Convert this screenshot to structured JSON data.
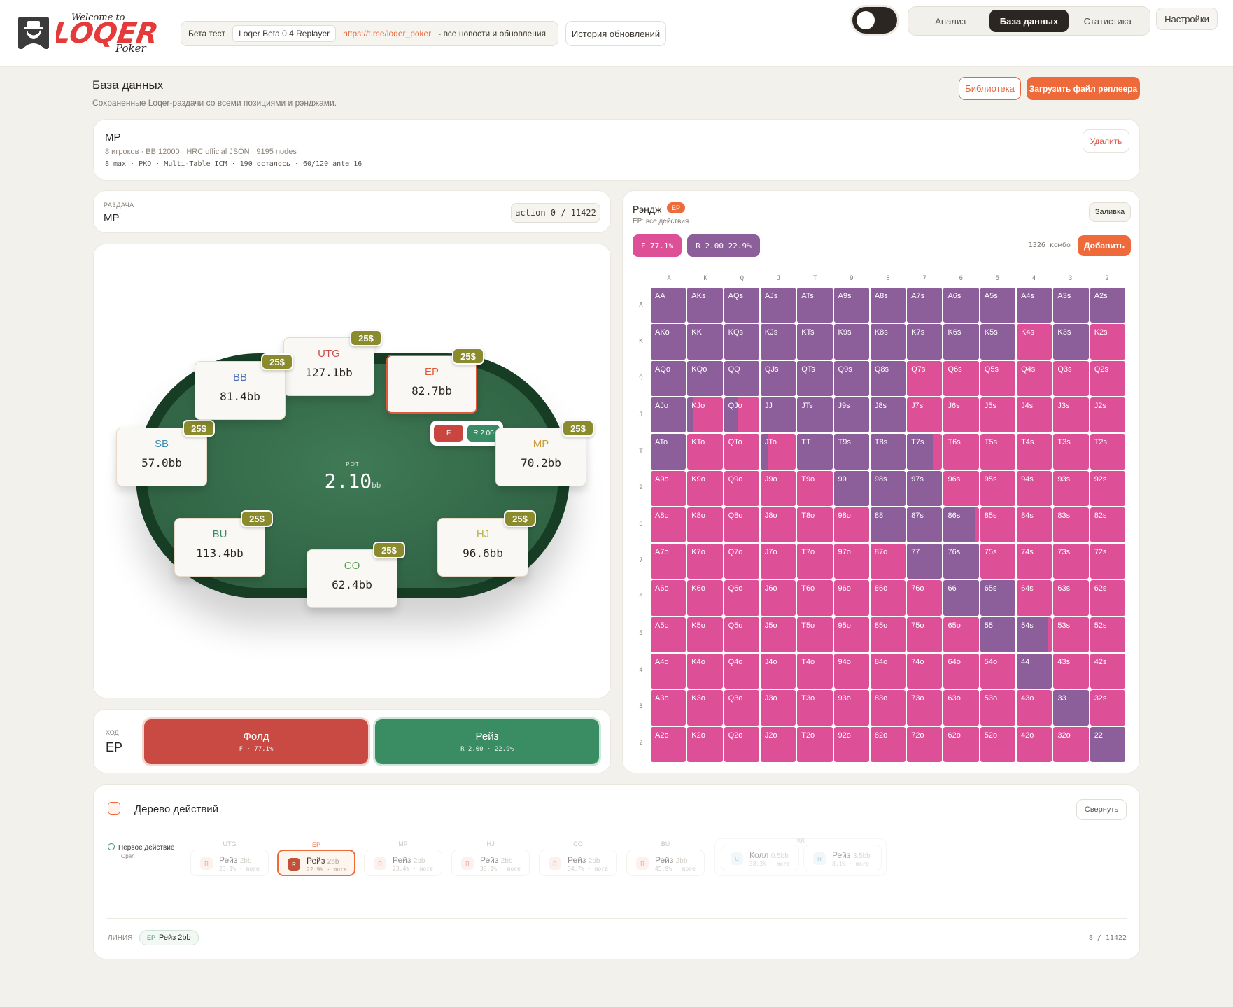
{
  "header": {
    "logo_alt": "Welcome to LOQER Poker",
    "beta_label": "Бета тест",
    "version_tag": "Loqer Beta 0.4 Replayer",
    "link": "https://t.me/loqer_poker",
    "link_suffix": "- все новости и обновления",
    "history_button": "История обновлений",
    "tabs": [
      "Анализ",
      "База данных",
      "Статистика"
    ],
    "active_tab": "База данных",
    "settings_button": "Настройки"
  },
  "page": {
    "title": "База данных",
    "subtitle": "Сохраненные Loqer-раздачи со всеми позициями и рэнджами.",
    "library_button": "Библиотека",
    "upload_button": "Загрузить файл реплеера"
  },
  "hand": {
    "name": "MP",
    "meta": "8 игроков · BB 12000 · HRC official JSON · 9195 nodes",
    "meta2": "8 max · PKO · Multi-Table ICM · 190 осталось · 60/120 ante 16",
    "delete_button": "Удалить"
  },
  "deal": {
    "label": "РАЗДАЧА",
    "name": "MP",
    "action_counter": "action 0 / 11422"
  },
  "table": {
    "pot_label": "POT",
    "pot_value": "2.10",
    "pot_unit": "bb",
    "seats": [
      {
        "pos": "UTG",
        "stack": "127.1bb",
        "chip": "25$",
        "color": "#c8504e"
      },
      {
        "pos": "EP",
        "stack": "82.7bb",
        "chip": "25$",
        "color": "#e2583a"
      },
      {
        "pos": "MP",
        "stack": "70.2bb",
        "chip": "25$",
        "color": "#c89a3c"
      },
      {
        "pos": "HJ",
        "stack": "96.6bb",
        "chip": "25$",
        "color": "#b9b34a"
      },
      {
        "pos": "CO",
        "stack": "62.4bb",
        "chip": "25$",
        "color": "#5a9e55"
      },
      {
        "pos": "BU",
        "stack": "113.4bb",
        "chip": "25$",
        "color": "#3a8d63"
      },
      {
        "pos": "SB",
        "stack": "57.0bb",
        "chip": "25$",
        "color": "#3a8fb5"
      },
      {
        "pos": "BB",
        "stack": "81.4bb",
        "chip": "25$",
        "color": "#4a6fb5"
      }
    ],
    "active_actions": {
      "fold": "F",
      "raise": "R 2.00"
    }
  },
  "move": {
    "label": "ХОД",
    "position": "EP",
    "fold_title": "Фолд",
    "fold_sub": "F · 77.1%",
    "raise_title": "Рейз",
    "raise_sub": "R 2.00 · 22.9%"
  },
  "range": {
    "title": "Рэндж",
    "badge": "EP",
    "subtitle": "EP: все действия",
    "fill_button": "Заливка",
    "fold_pill": "F 77.1%",
    "raise_pill": "R 2.00 22.9%",
    "combo_count": "1326 комбо",
    "add_button": "Добавить",
    "ranks": [
      "A",
      "K",
      "Q",
      "J",
      "T",
      "9",
      "8",
      "7",
      "6",
      "5",
      "4",
      "3",
      "2"
    ],
    "colors": {
      "fold": "#dd4f96",
      "raise": "#8c5e9a"
    },
    "raise_freq": [
      [
        1,
        1,
        1,
        1,
        1,
        1,
        1,
        1,
        1,
        1,
        1,
        1,
        1
      ],
      [
        1,
        1,
        1,
        1,
        1,
        1,
        1,
        1,
        1,
        1,
        0,
        1,
        0
      ],
      [
        1,
        1,
        1,
        1,
        1,
        1,
        1,
        0,
        0,
        0,
        0,
        0,
        0
      ],
      [
        1,
        0.15,
        0.4,
        1,
        1,
        1,
        1,
        0,
        0,
        0,
        0,
        0,
        0
      ],
      [
        1,
        0,
        0,
        0.2,
        1,
        1,
        1,
        0.75,
        0,
        0,
        0,
        0,
        0
      ],
      [
        0,
        0,
        0,
        0,
        0,
        1,
        1,
        1,
        0,
        0,
        0,
        0,
        0
      ],
      [
        0,
        0,
        0,
        0,
        0,
        0,
        1,
        1,
        0.9,
        0,
        0,
        0,
        0
      ],
      [
        0,
        0,
        0,
        0,
        0,
        0,
        0,
        1,
        1,
        0,
        0,
        0,
        0
      ],
      [
        0,
        0,
        0,
        0,
        0,
        0,
        0,
        0,
        1,
        1,
        0,
        0,
        0
      ],
      [
        0,
        0,
        0,
        0,
        0,
        0,
        0,
        0,
        0,
        1,
        0.9,
        0,
        0
      ],
      [
        0,
        0,
        0,
        0,
        0,
        0,
        0,
        0,
        0,
        0,
        1,
        0,
        0
      ],
      [
        0,
        0,
        0,
        0,
        0,
        0,
        0,
        0,
        0,
        0,
        0,
        1,
        0
      ],
      [
        0,
        0,
        0,
        0,
        0,
        0,
        0,
        0,
        0,
        0,
        0,
        0,
        1
      ]
    ]
  },
  "tree": {
    "title": "Дерево действий",
    "collapse_button": "Свернуть",
    "first_action": "Первое действие",
    "first_action_sub": "Open",
    "nodes": [
      {
        "pos": "UTG",
        "action": "Рейз",
        "size": "2bb",
        "freq": "23.1% · more"
      },
      {
        "pos": "EP",
        "action": "Рейз",
        "size": "2bb",
        "freq": "22.9% · more"
      },
      {
        "pos": "MP",
        "action": "Рейз",
        "size": "2bb",
        "freq": "23.4% · more"
      },
      {
        "pos": "HJ",
        "action": "Рейз",
        "size": "2bb",
        "freq": "33.1% · more"
      },
      {
        "pos": "CO",
        "action": "Рейз",
        "size": "2bb",
        "freq": "34.7% · more"
      },
      {
        "pos": "BU",
        "action": "Рейз",
        "size": "2bb",
        "freq": "45.9% · more"
      }
    ],
    "sb_group": {
      "pos": "SB",
      "nodes": [
        {
          "action": "Колл",
          "size": "0.5bb",
          "freq": "38.3% · more"
        },
        {
          "action": "Рейз",
          "size": "3.5bb",
          "freq": "8.1% · more"
        }
      ]
    },
    "line_label": "ЛИНИЯ",
    "line_pos": "EP",
    "line_action": "Рейз 2bb",
    "count": "8 / 11422"
  }
}
